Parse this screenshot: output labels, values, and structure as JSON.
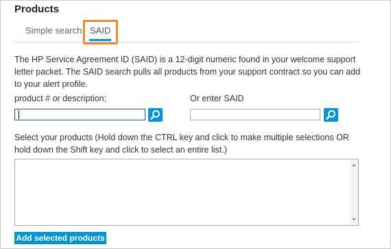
{
  "panel": {
    "title": "Products"
  },
  "tabs": [
    {
      "label": "Simple search",
      "active": false
    },
    {
      "label": "SAID",
      "active": true
    }
  ],
  "description": "The HP Service Agreement ID (SAID) is a 12-digit numeric found in your welcome support letter packet. The SAID search pulls all products from your support contract so you can add to your alert profile.",
  "product_search": {
    "label": "product # or description:",
    "value": "",
    "button_icon": "search-icon"
  },
  "said_search": {
    "label": "Or enter SAID",
    "value": "",
    "button_icon": "search-icon"
  },
  "select_instructions": "Select your products (Hold down the CTRL key and click to make multiple selections OR hold down the Shift key and click to select an entire list.)",
  "products_list": {
    "items": []
  },
  "add_button": {
    "label": "Add selected products"
  },
  "colors": {
    "accent": "#0096d6",
    "highlight": "#f28a2c",
    "active_input_border": "#1a4fb5"
  }
}
